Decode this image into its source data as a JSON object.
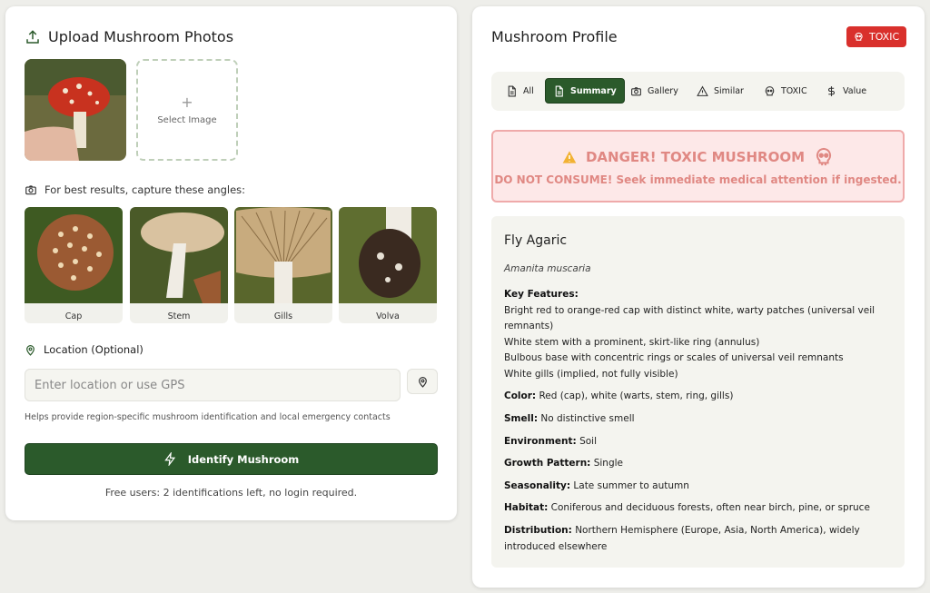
{
  "upload": {
    "title": "Upload Mushroom Photos",
    "select_image_label": "Select Image",
    "angles_hint": "For best results, capture these angles:",
    "angles": [
      {
        "label": "Cap"
      },
      {
        "label": "Stem"
      },
      {
        "label": "Gills"
      },
      {
        "label": "Volva"
      }
    ],
    "location_label": "Location (Optional)",
    "location_placeholder": "Enter location or use GPS",
    "help_text": "Helps provide region-specific mushroom identification and local emergency contacts",
    "identify_label": "Identify Mushroom",
    "free_users_text": "Free users: 2 identifications left, no login required."
  },
  "profile": {
    "title": "Mushroom Profile",
    "badge": "TOXIC",
    "tabs": [
      {
        "label": "All",
        "icon": "document-icon"
      },
      {
        "label": "Summary",
        "icon": "document-icon",
        "active": true
      },
      {
        "label": "Gallery",
        "icon": "camera-icon"
      },
      {
        "label": "Similar",
        "icon": "warning-icon"
      },
      {
        "label": "TOXIC",
        "icon": "skull-icon"
      },
      {
        "label": "Value",
        "icon": "dollar-icon"
      }
    ],
    "danger_title": "DANGER! TOXIC MUSHROOM",
    "danger_subtitle": "DO NOT CONSUME! Seek immediate medical attention if ingested.",
    "common_name": "Fly Agaric",
    "scientific_name": "Amanita muscaria",
    "key_features_label": "Key Features:",
    "key_features": [
      "Bright red to orange-red cap with distinct white, warty patches (universal veil remnants)",
      "White stem with a prominent, skirt-like ring (annulus)",
      "Bulbous base with concentric rings or scales of universal veil remnants",
      "White gills (implied, not fully visible)"
    ],
    "attributes": [
      {
        "label": "Color:",
        "value": "Red (cap), white (warts, stem, ring, gills)"
      },
      {
        "label": "Smell:",
        "value": "No distinctive smell"
      },
      {
        "label": "Environment:",
        "value": "Soil"
      },
      {
        "label": "Growth Pattern:",
        "value": "Single"
      },
      {
        "label": "Seasonality:",
        "value": "Late summer to autumn"
      },
      {
        "label": "Habitat:",
        "value": "Coniferous and deciduous forests, often near birch, pine, or spruce"
      },
      {
        "label": "Distribution:",
        "value": "Northern Hemisphere (Europe, Asia, North America), widely introduced elsewhere"
      }
    ]
  },
  "colors": {
    "accent_green": "#2b5a2b",
    "toxic_red": "#d9302c",
    "danger_text": "#e08883",
    "danger_bg": "#fde8e8"
  }
}
